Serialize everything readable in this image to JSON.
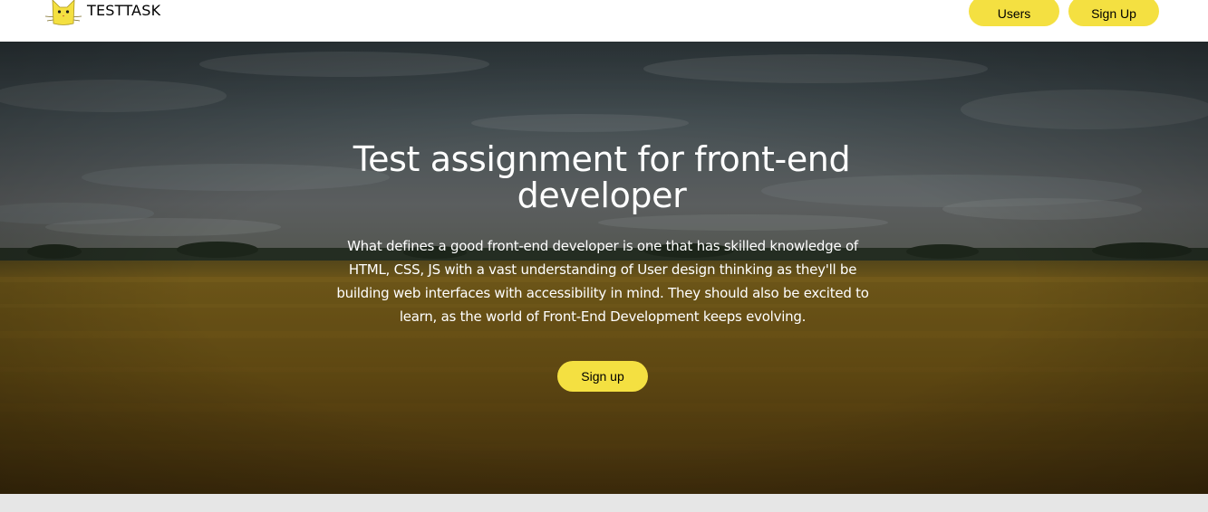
{
  "header": {
    "logo_text": "TESTTASK",
    "logo_icon": "cat-logo-icon",
    "nav": [
      {
        "label": "Users"
      },
      {
        "label": "Sign Up"
      }
    ]
  },
  "hero": {
    "background": "wheat-field-photo",
    "title": "Test assignment for front-end developer",
    "text": "What defines a good front-end developer is one that has skilled knowledge of HTML, CSS, JS with a vast understanding of User design thinking as they'll be building web interfaces with accessibility in mind. They should also be excited to learn, as the world of Front-End Development keeps evolving.",
    "cta_label": "Sign up"
  },
  "colors": {
    "accent": "#f4e041",
    "header_bg": "#ffffff",
    "page_bg": "#e6e6e6",
    "hero_text": "#ffffff"
  }
}
